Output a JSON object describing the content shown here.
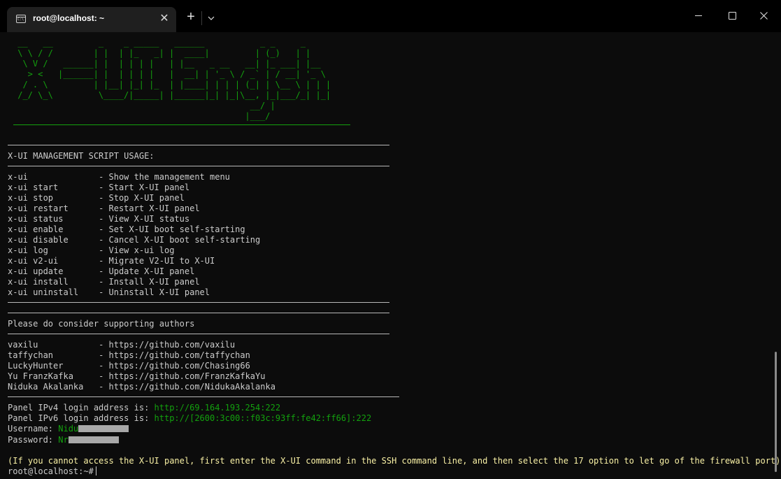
{
  "window": {
    "tab_title": "root@localhost: ~",
    "tab_close_glyph": "✕",
    "new_tab_glyph": "+",
    "icons": [
      "terminal-icon",
      "close-icon",
      "plus-icon",
      "chevron-down-icon",
      "minimize-icon",
      "maximize-icon",
      "close-window-icon"
    ]
  },
  "banner": {
    "color": "#13a10e",
    "lines": [
      " __   __         _    _ _____   ______           _ _     _    ",
      " \\ \\ / /        | |  | |_   _| |  ____|         | (_)   | |   ",
      "  \\ V /   ______| |  | | | |   | |__   _ __   __| |_ ___| |__ ",
      "   > <   |______| |  | | | |   |  __| | '_ \\ / _` | / __| '_ \\",
      "  / . \\         | |__| |_| |_  | |____| | | | (_| | \\__ \\ | | |",
      " /_/ \\_\\         \\____/|_____| |______|_| |_|\\__, |_|___/_| |_|",
      "                                               __/ |            ",
      "                                              |___/             "
    ]
  },
  "usage": {
    "header": "X-UI MANAGEMENT SCRIPT USAGE:",
    "commands": [
      {
        "cmd": "x-ui             ",
        "desc": "- Show the management menu"
      },
      {
        "cmd": "x-ui start       ",
        "desc": "- Start X-UI panel"
      },
      {
        "cmd": "x-ui stop        ",
        "desc": "- Stop X-UI panel"
      },
      {
        "cmd": "x-ui restart     ",
        "desc": "- Restart X-UI panel"
      },
      {
        "cmd": "x-ui status      ",
        "desc": "- View X-UI status"
      },
      {
        "cmd": "x-ui enable      ",
        "desc": "- Set X-UI boot self-starting"
      },
      {
        "cmd": "x-ui disable     ",
        "desc": "- Cancel X-UI boot self-starting"
      },
      {
        "cmd": "x-ui log         ",
        "desc": "- View x-ui log"
      },
      {
        "cmd": "x-ui v2-ui       ",
        "desc": "- Migrate V2-UI to X-UI"
      },
      {
        "cmd": "x-ui update      ",
        "desc": "- Update X-UI panel"
      },
      {
        "cmd": "x-ui install     ",
        "desc": "- Install X-UI panel"
      },
      {
        "cmd": "x-ui uninstall   ",
        "desc": "- Uninstall X-UI panel"
      }
    ]
  },
  "authors": {
    "header": "Please do consider supporting authors",
    "list": [
      {
        "name": "vaxilu           ",
        "url": "- https://github.com/vaxilu"
      },
      {
        "name": "taffychan        ",
        "url": "- https://github.com/taffychan"
      },
      {
        "name": "LuckyHunter      ",
        "url": "- https://github.com/Chasing66"
      },
      {
        "name": "Yu FranzKafka    ",
        "url": "- https://github.com/FranzKafkaYu"
      },
      {
        "name": "Niduka Akalanka  ",
        "url": "- https://github.com/NidukaAkalanka"
      }
    ]
  },
  "login": {
    "ipv4_label": "Panel IPv4 login address is: ",
    "ipv4_url": "http://69.164.193.254:222",
    "ipv6_label": "Panel IPv6 login address is: ",
    "ipv6_url": "http://[2600:3c00::f03c:93ff:fe42:ff66]:222",
    "username_label": "Username: ",
    "username_value": "Nidu",
    "password_label": "Password: ",
    "password_value": "Nr"
  },
  "hint": "(If you cannot access the X-UI panel, first enter the X-UI command in the SSH command line, and then select the 17 option to let go of the firewall port)",
  "prompt": "root@localhost:~#",
  "colors": {
    "background": "#0c0c0c",
    "text": "#cccccc",
    "green": "#13a10e",
    "yellow": "#f9f1a5"
  }
}
